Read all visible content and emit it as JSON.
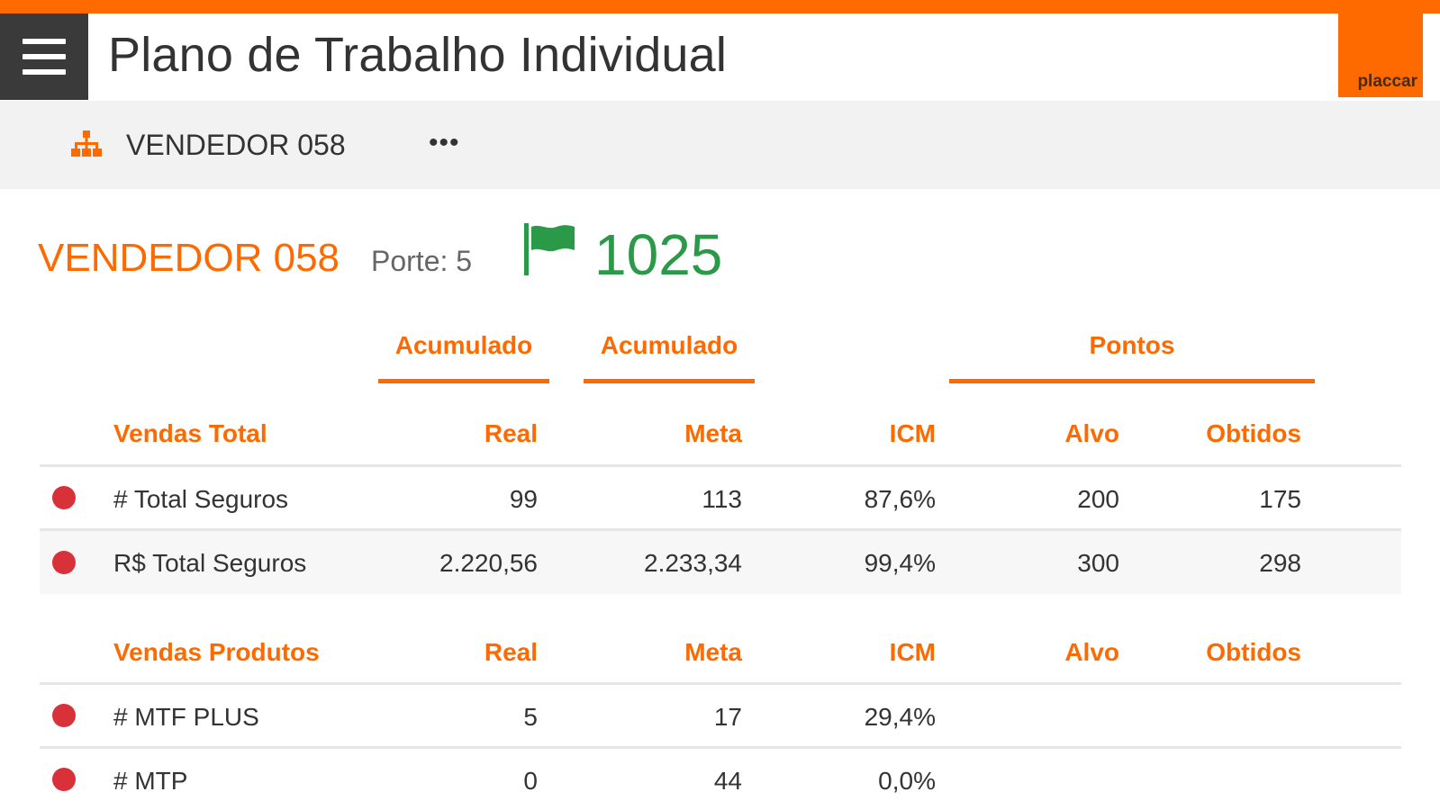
{
  "app": {
    "title": "Plano de Trabalho Individual",
    "logo_text": "placcar",
    "accent_color": "#ff6a00",
    "score_color": "#2a9a48",
    "status_color": "#d9313a"
  },
  "subbar": {
    "icon": "org-chart-icon",
    "name": "VENDEDOR 058",
    "more_label": "•••"
  },
  "summary": {
    "name": "VENDEDOR 058",
    "porte": "Porte: 5",
    "flag_icon": "flag-icon",
    "score": "1025"
  },
  "groups": [
    {
      "label": "Acumulado"
    },
    {
      "label": "Acumulado"
    },
    {
      "label": "Pontos"
    }
  ],
  "sections": [
    {
      "headers": [
        "Vendas Total",
        "Real",
        "Meta",
        "ICM",
        "Alvo",
        "Obtidos"
      ],
      "rows": [
        {
          "status": "red",
          "name": "# Total Seguros",
          "real": "99",
          "meta": "113",
          "icm": "87,6%",
          "alvo": "200",
          "obtidos": "175"
        },
        {
          "status": "red",
          "name": "R$ Total Seguros",
          "real": "2.220,56",
          "meta": "2.233,34",
          "icm": "99,4%",
          "alvo": "300",
          "obtidos": "298"
        }
      ]
    },
    {
      "headers": [
        "Vendas Produtos",
        "Real",
        "Meta",
        "ICM",
        "Alvo",
        "Obtidos"
      ],
      "rows": [
        {
          "status": "red",
          "name": "# MTF PLUS",
          "real": "5",
          "meta": "17",
          "icm": "29,4%",
          "alvo": "",
          "obtidos": ""
        },
        {
          "status": "red",
          "name": "# MTP",
          "real": "0",
          "meta": "44",
          "icm": "0,0%",
          "alvo": "",
          "obtidos": ""
        }
      ]
    }
  ]
}
